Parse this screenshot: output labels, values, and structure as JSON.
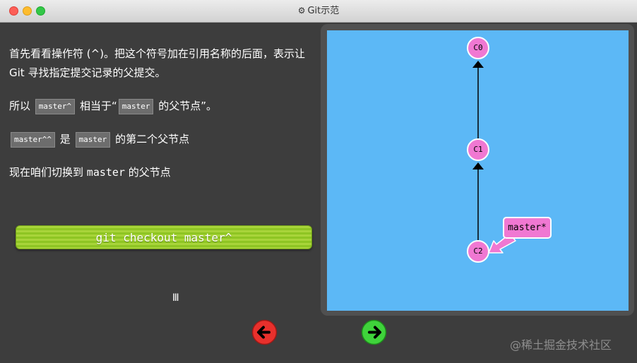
{
  "window": {
    "title": "Git示范",
    "title_icon": "gear-icon"
  },
  "instructions": {
    "p1": "首先看看操作符 (^)。把这个符号加在引用名称的后面，表示让 Git 寻找指定提交记录的父提交。",
    "p2_prefix": "所以",
    "p2_code1": "master^",
    "p2_mid": "相当于“",
    "p2_code2": "master",
    "p2_suffix": "的父节点”。",
    "p3_code": "master^^",
    "p3_mid": "是",
    "p3_code2": "master",
    "p3_suffix": "的第二个父节点",
    "p4_prefix": "现在咱们切换到",
    "p4_code": "master",
    "p4_suffix": "的父节点"
  },
  "command_button": {
    "label": "git checkout master^",
    "color": "#9acd32"
  },
  "graph": {
    "background": "#5cb8f6",
    "node_color": "#f078d2",
    "commits": [
      {
        "id": "C0"
      },
      {
        "id": "C1"
      },
      {
        "id": "C2"
      }
    ],
    "branch_label": "master*"
  },
  "nav": {
    "back_icon": "left-arrow-icon",
    "back_color": "#e8302c",
    "forward_icon": "right-arrow-icon",
    "forward_color": "#3fd33b"
  },
  "watermark": "@稀土掘金技术社区"
}
